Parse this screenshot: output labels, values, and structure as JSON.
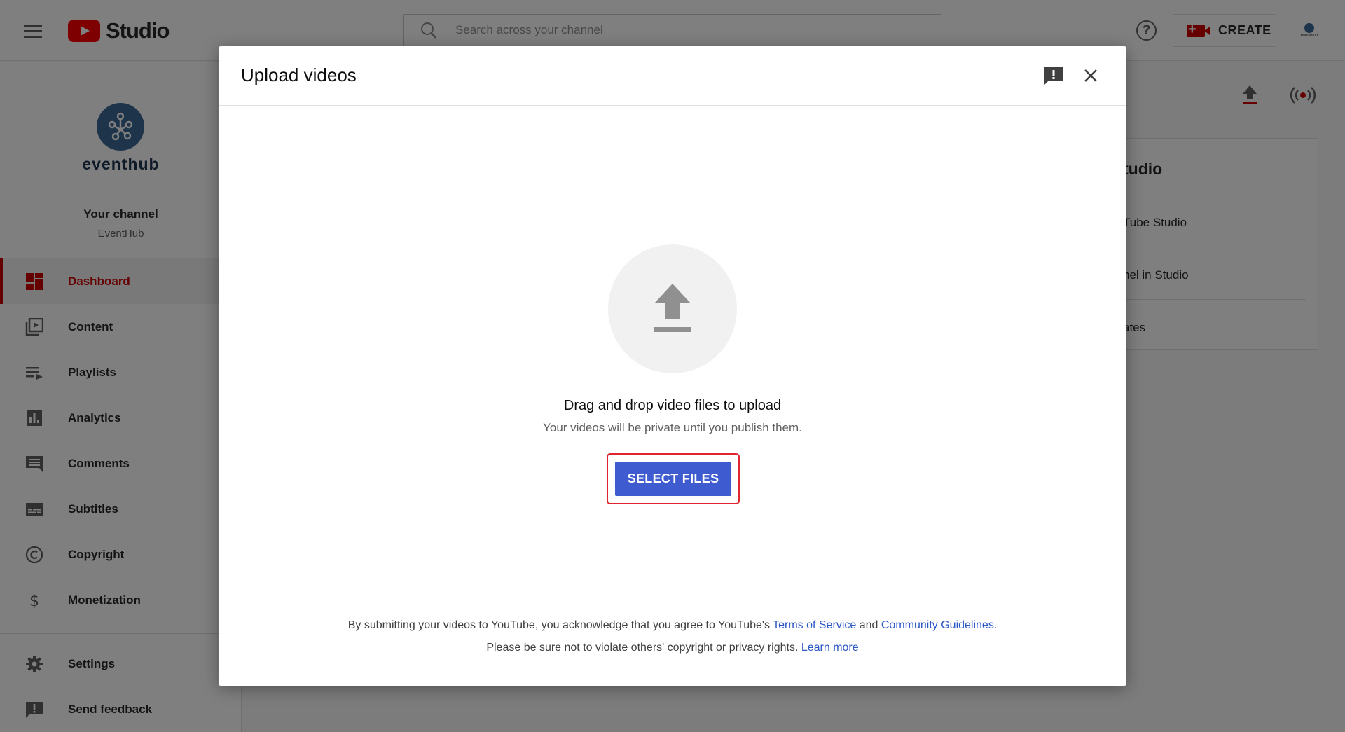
{
  "header": {
    "logo_text": "Studio",
    "search_placeholder": "Search across your channel",
    "help_glyph": "?",
    "create_label": "CREATE",
    "avatar_text": "eventhub"
  },
  "sidebar": {
    "brand_name": "eventhub",
    "your_channel_label": "Your channel",
    "channel_name": "EventHub",
    "items": [
      {
        "label": "Dashboard",
        "icon": "dashboard-icon",
        "active": true
      },
      {
        "label": "Content",
        "icon": "content-icon"
      },
      {
        "label": "Playlists",
        "icon": "playlists-icon"
      },
      {
        "label": "Analytics",
        "icon": "analytics-icon"
      },
      {
        "label": "Comments",
        "icon": "comments-icon"
      },
      {
        "label": "Subtitles",
        "icon": "subtitles-icon"
      },
      {
        "label": "Copyright",
        "icon": "copyright-icon"
      },
      {
        "label": "Monetization",
        "icon": "monetization-icon"
      }
    ],
    "bottom_items": [
      {
        "label": "Settings",
        "icon": "settings-icon"
      },
      {
        "label": "Send feedback",
        "icon": "feedback-icon"
      }
    ]
  },
  "background_card": {
    "title": "tudio",
    "rows": [
      "Tube Studio",
      "nel in Studio",
      "ates"
    ]
  },
  "modal": {
    "title": "Upload videos",
    "drag_text": "Drag and drop video files to upload",
    "private_text": "Your videos will be private until you publish them.",
    "select_button": "SELECT FILES",
    "legal_line1_prefix": "By submitting your videos to YouTube, you acknowledge that you agree to YouTube's ",
    "terms_link": "Terms of Service",
    "legal_and": " and ",
    "guidelines_link": "Community Guidelines",
    "legal_line1_suffix": ".",
    "legal_line2_prefix": "Please be sure not to violate others' copyright or privacy rights. ",
    "learn_more_link": "Learn more"
  },
  "colors": {
    "accent_red": "#cc0000",
    "button_blue": "#3e5ccf",
    "link_blue": "#2a56c6",
    "highlight_outline": "#e0242f"
  }
}
